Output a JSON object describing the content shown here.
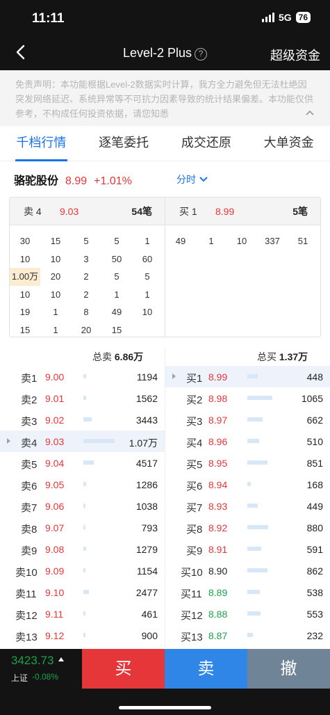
{
  "status": {
    "time": "11:11",
    "network": "5G",
    "battery": "76"
  },
  "nav": {
    "title": "Level-2 Plus",
    "help_glyph": "?",
    "right_link": "超级资金"
  },
  "disclaimer": {
    "text": "免责声明：本功能根据Level-2数据实时计算，我方全力避免但无法杜绝因突发网络延迟、系统异常等不可抗力因素导致的统计结果偏差。本功能仅供参考，不构成任何投资依据，请您知悉"
  },
  "tabs": [
    "千档行情",
    "逐笔委托",
    "成交还原",
    "大单资金"
  ],
  "stock": {
    "name": "骆驼股份",
    "price": "8.99",
    "change": "+1.01%",
    "view_mode": "分时"
  },
  "queue": {
    "sell": {
      "label": "卖 4",
      "price": "9.03",
      "count": "54笔",
      "cells": [
        "30",
        "15",
        "5",
        "5",
        "1",
        "10",
        "10",
        "3",
        "50",
        "60",
        "1.00万",
        "20",
        "2",
        "5",
        "5",
        "10",
        "10",
        "2",
        "1",
        "1",
        "19",
        "1",
        "8",
        "49",
        "10",
        "15",
        "1",
        "20",
        "15",
        ""
      ]
    },
    "buy": {
      "label": "买 1",
      "price": "8.99",
      "count": "5笔",
      "cells": [
        "49",
        "1",
        "10",
        "337",
        "51"
      ]
    }
  },
  "totals": {
    "sell_label": "总卖",
    "sell_value": "6.86万",
    "buy_label": "总买",
    "buy_value": "1.37万"
  },
  "book": {
    "sell": [
      {
        "label": "卖1",
        "price": "9.00",
        "volume": "1194",
        "bar": 0.06
      },
      {
        "label": "卖2",
        "price": "9.01",
        "volume": "1562",
        "bar": 0.06
      },
      {
        "label": "卖3",
        "price": "9.02",
        "volume": "3443",
        "bar": 0.2
      },
      {
        "label": "卖4",
        "price": "9.03",
        "volume": "1.07万",
        "bar": 0.75,
        "selected": true
      },
      {
        "label": "卖5",
        "price": "9.04",
        "volume": "4517",
        "bar": 0.25
      },
      {
        "label": "卖6",
        "price": "9.05",
        "volume": "1286",
        "bar": 0.06
      },
      {
        "label": "卖7",
        "price": "9.06",
        "volume": "1038",
        "bar": 0.05
      },
      {
        "label": "卖8",
        "price": "9.07",
        "volume": "793",
        "bar": 0.04
      },
      {
        "label": "卖9",
        "price": "9.08",
        "volume": "1279",
        "bar": 0.06
      },
      {
        "label": "卖10",
        "price": "9.09",
        "volume": "1154",
        "bar": 0.05
      },
      {
        "label": "卖11",
        "price": "9.10",
        "volume": "2477",
        "bar": 0.13
      },
      {
        "label": "卖12",
        "price": "9.11",
        "volume": "461",
        "bar": 0.02
      },
      {
        "label": "卖13",
        "price": "9.12",
        "volume": "900",
        "bar": 0.04
      }
    ],
    "buy": [
      {
        "label": "买1",
        "price": "8.99",
        "volume": "448",
        "bar": 0.25,
        "selected": true,
        "tone": "red"
      },
      {
        "label": "买2",
        "price": "8.98",
        "volume": "1065",
        "bar": 0.6,
        "tone": "red"
      },
      {
        "label": "买3",
        "price": "8.97",
        "volume": "662",
        "bar": 0.36,
        "tone": "red"
      },
      {
        "label": "买4",
        "price": "8.96",
        "volume": "510",
        "bar": 0.28,
        "tone": "red"
      },
      {
        "label": "买5",
        "price": "8.95",
        "volume": "851",
        "bar": 0.48,
        "tone": "red"
      },
      {
        "label": "买6",
        "price": "8.94",
        "volume": "168",
        "bar": 0.09,
        "tone": "red"
      },
      {
        "label": "买7",
        "price": "8.93",
        "volume": "449",
        "bar": 0.25,
        "tone": "red"
      },
      {
        "label": "买8",
        "price": "8.92",
        "volume": "880",
        "bar": 0.5,
        "tone": "red"
      },
      {
        "label": "买9",
        "price": "8.91",
        "volume": "591",
        "bar": 0.33,
        "tone": "red"
      },
      {
        "label": "买10",
        "price": "8.90",
        "volume": "862",
        "bar": 0.48,
        "tone": "black"
      },
      {
        "label": "买11",
        "price": "8.89",
        "volume": "538",
        "bar": 0.3,
        "tone": "green"
      },
      {
        "label": "买12",
        "price": "8.88",
        "volume": "553",
        "bar": 0.31,
        "tone": "green"
      },
      {
        "label": "买13",
        "price": "8.87",
        "volume": "232",
        "bar": 0.13,
        "tone": "green"
      }
    ]
  },
  "bottom": {
    "index_value": "3423.73",
    "index_name": "上证",
    "index_change": "-0.08%",
    "buy_label": "买",
    "sell_label": "卖",
    "cancel_label": "撤"
  },
  "colors": {
    "up": "#e43638",
    "down": "#1aa34a",
    "accent": "#1a73e8",
    "buy_btn": "#e5363a",
    "sell_btn": "#2f86e6",
    "cancel_btn": "#6f8597"
  }
}
